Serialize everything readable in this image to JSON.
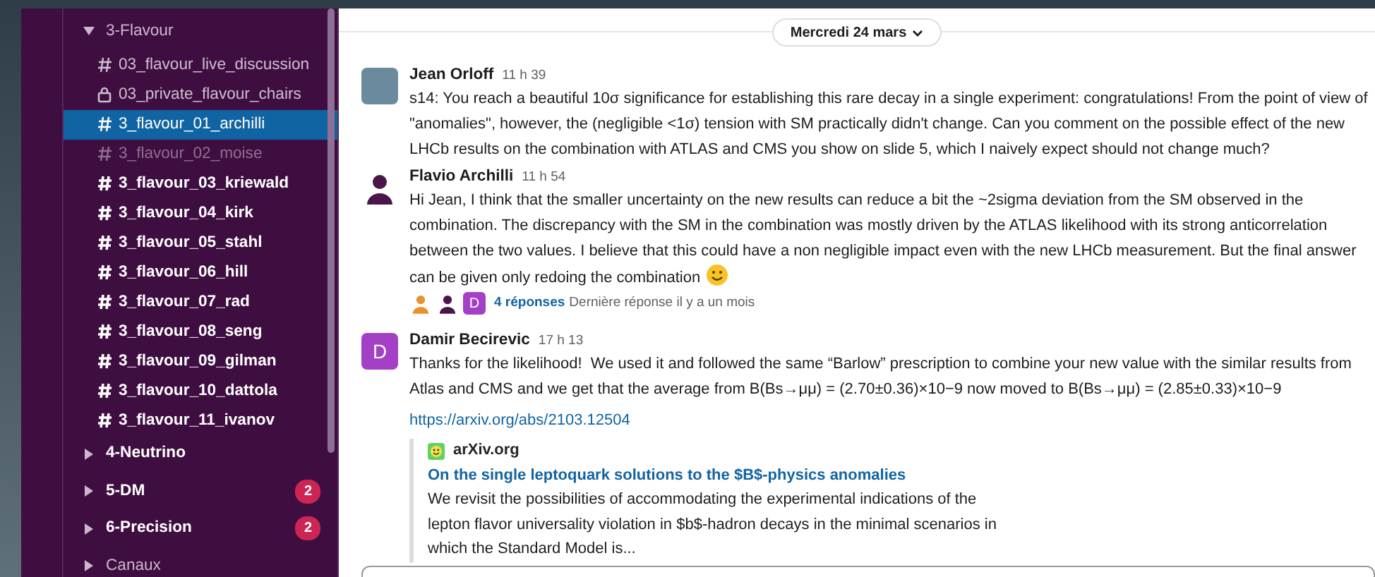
{
  "sidebar": {
    "sections": [
      {
        "name": "3-Flavour",
        "expanded": true,
        "unread": false,
        "channels": [
          {
            "name": "03_flavour_live_discussion",
            "kind": "public",
            "unread": false,
            "muted": false,
            "selected": false
          },
          {
            "name": "03_private_flavour_chairs",
            "kind": "private",
            "unread": false,
            "muted": false,
            "selected": false
          },
          {
            "name": "3_flavour_01_archilli",
            "kind": "public",
            "unread": false,
            "muted": false,
            "selected": true
          },
          {
            "name": "3_flavour_02_moise",
            "kind": "public",
            "unread": false,
            "muted": true,
            "selected": false
          },
          {
            "name": "3_flavour_03_kriewald",
            "kind": "public",
            "unread": true,
            "muted": false,
            "selected": false
          },
          {
            "name": "3_flavour_04_kirk",
            "kind": "public",
            "unread": true,
            "muted": false,
            "selected": false
          },
          {
            "name": "3_flavour_05_stahl",
            "kind": "public",
            "unread": true,
            "muted": false,
            "selected": false
          },
          {
            "name": "3_flavour_06_hill",
            "kind": "public",
            "unread": true,
            "muted": false,
            "selected": false
          },
          {
            "name": "3_flavour_07_rad",
            "kind": "public",
            "unread": true,
            "muted": false,
            "selected": false
          },
          {
            "name": "3_flavour_08_seng",
            "kind": "public",
            "unread": true,
            "muted": false,
            "selected": false
          },
          {
            "name": "3_flavour_09_gilman",
            "kind": "public",
            "unread": true,
            "muted": false,
            "selected": false
          },
          {
            "name": "3_flavour_10_dattola",
            "kind": "public",
            "unread": true,
            "muted": false,
            "selected": false
          },
          {
            "name": "3_flavour_11_ivanov",
            "kind": "public",
            "unread": true,
            "muted": false,
            "selected": false
          }
        ]
      },
      {
        "name": "4-Neutrino",
        "expanded": false,
        "unread": true
      },
      {
        "name": "5-DM",
        "expanded": false,
        "unread": true,
        "badge": "2"
      },
      {
        "name": "6-Precision",
        "expanded": false,
        "unread": true,
        "badge": "2"
      },
      {
        "name": "Canaux",
        "expanded": false,
        "unread": false
      }
    ]
  },
  "main": {
    "date_divider": {
      "label": "Mercredi 24 mars"
    },
    "messages": [
      {
        "author": "Jean Orloff",
        "time": "11 h 39",
        "avatar": {
          "kind": "photo"
        },
        "text": "s14: You reach a beautiful 10σ significance for establishing this rare decay in a single experiment: congratulations! From the point of view of\n\"anomalies\", however, the (negligible <1σ) tension with SM practically didn't change. Can you comment on the possible effect of the new\nLHCb results on the combination with ATLAS and CMS you show on slide 5, which I naively expect should not change much?"
      },
      {
        "author": "Flavio Archilli",
        "time": "11 h 54",
        "avatar": {
          "kind": "generic",
          "color": "#4a154b"
        },
        "text": "Hi Jean, I think that the smaller uncertainty on the new results can reduce a bit the ~2sigma deviation from the SM observed in the\ncombination. The discrepancy with the SM in the combination was mostly driven by the ATLAS likelihood with its strong anticorrelation\nbetween the two values. I believe that this could have a non negligible impact even with the new LHCb measurement. But the final answer\ncan be given only redoing the combination",
        "emoji": true,
        "thread": {
          "avatars": [
            {
              "kind": "generic",
              "color": "#e8912d"
            },
            {
              "kind": "generic",
              "color": "#4a154b"
            },
            {
              "kind": "initial",
              "initial": "D",
              "color": "#a340c6"
            }
          ],
          "replies": "4 réponses",
          "last_reply": "Dernière réponse il y a un mois"
        }
      },
      {
        "author": "Damir Becirevic",
        "time": "17 h 13",
        "avatar": {
          "kind": "initial",
          "initial": "D",
          "color": "#a340c6"
        },
        "text": "Thanks for the likelihood!  We used it and followed the same “Barlow” prescription to combine your new value with the similar results from\nAtlas and CMS and we get that the average from B(Bs→μμ) = (2.70±0.36)×10−9 now moved to B(Bs→μμ) = (2.85±0.33)×10−9",
        "link": "https://arxiv.org/abs/2103.12504",
        "attachment": {
          "site": "arXiv.org",
          "title": "On the single leptoquark solutions to the $B$-physics anomalies",
          "description": "We revisit the possibilities of accommodating the experimental indications of the\nlepton flavor universality violation in $b$-hadron decays in the minimal scenarios in\nwhich the Standard Model is..."
        }
      }
    ]
  }
}
